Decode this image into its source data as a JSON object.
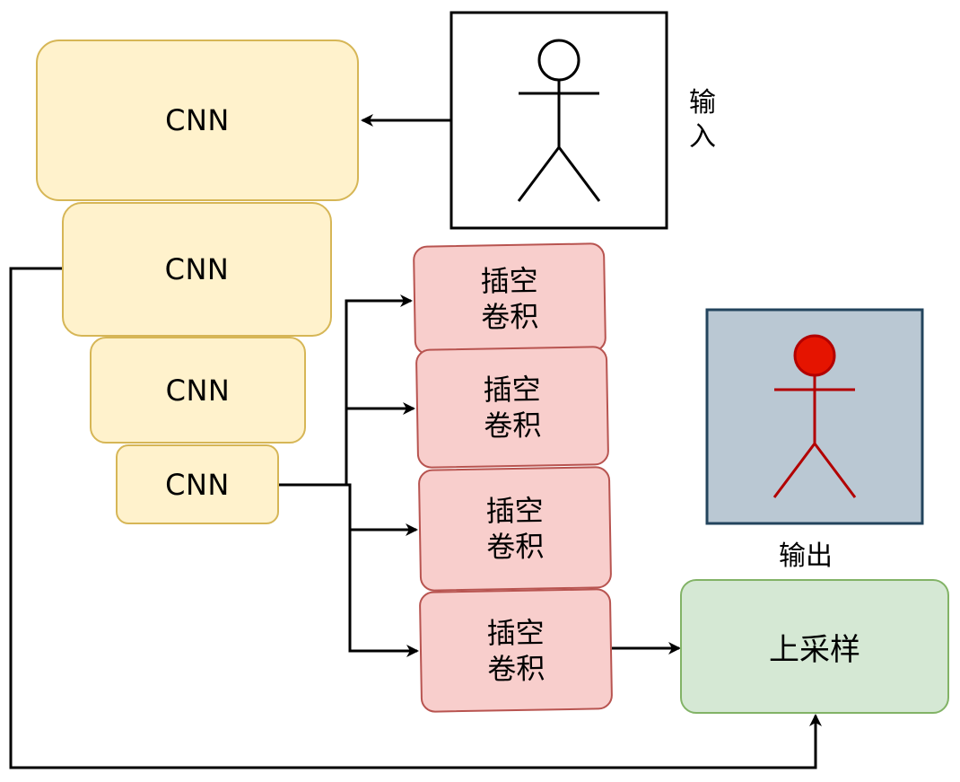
{
  "cnn_blocks": [
    {
      "label": "CNN"
    },
    {
      "label": "CNN"
    },
    {
      "label": "CNN"
    },
    {
      "label": "CNN"
    }
  ],
  "dilated_blocks": [
    {
      "label": "插空\n卷积"
    },
    {
      "label": "插空\n卷积"
    },
    {
      "label": "插空\n卷积"
    },
    {
      "label": "插空\n卷积"
    }
  ],
  "upsample": {
    "label": "上采样"
  },
  "input": {
    "label": "输\n入"
  },
  "output": {
    "label": "输出"
  },
  "colors": {
    "cnn_fill": "#fff2cc",
    "cnn_stroke": "#d6b656",
    "dilated_fill": "#f8cecc",
    "dilated_stroke": "#b85450",
    "upsample_fill": "#d5e8d4",
    "upsample_stroke": "#82b366",
    "output_box_fill": "#bac8d3",
    "output_box_stroke": "#23445d",
    "output_figure": "#e51400",
    "output_figure_stroke": "#b20000"
  }
}
